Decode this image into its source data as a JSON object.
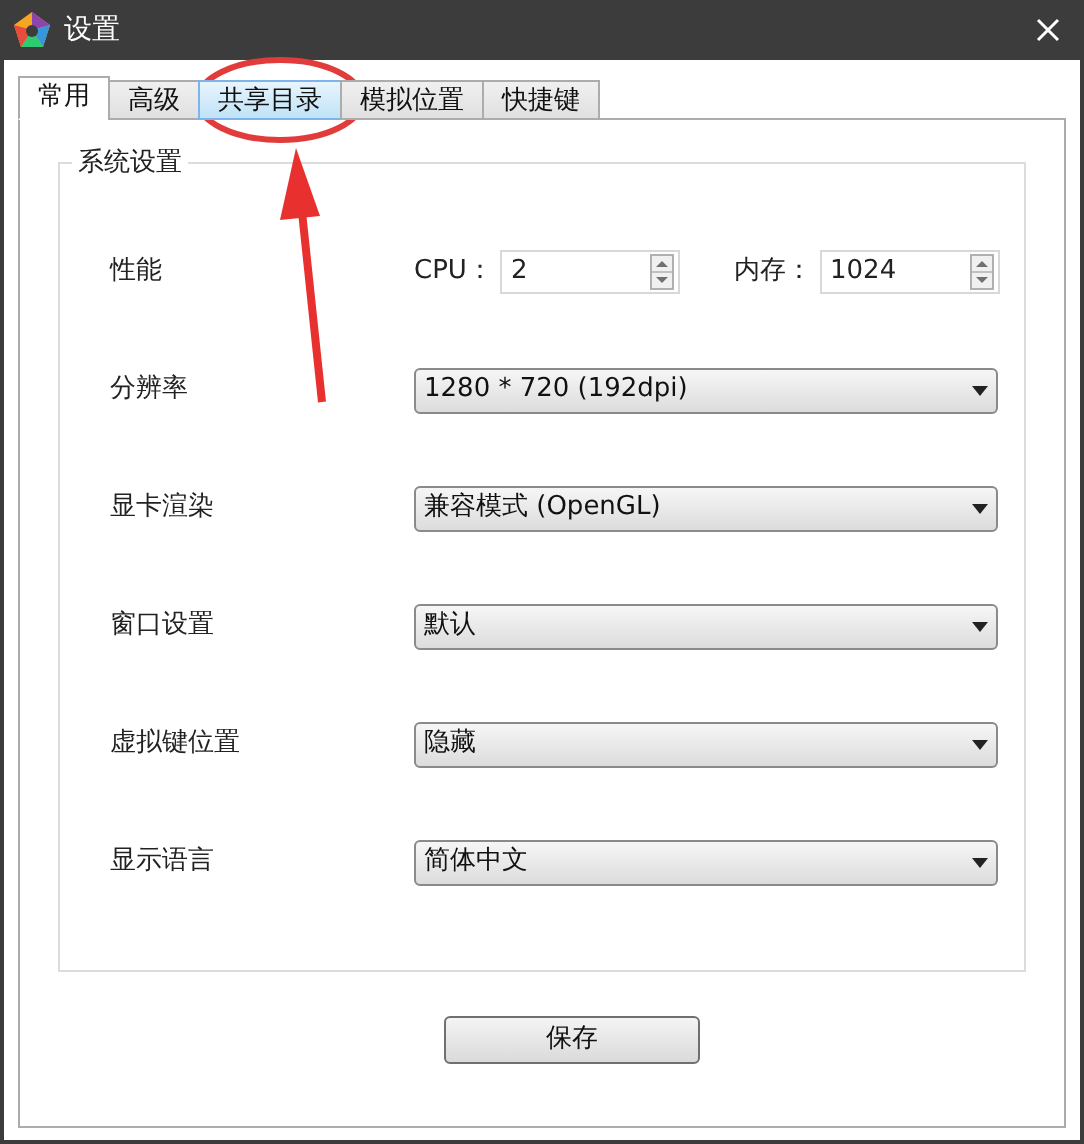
{
  "window": {
    "title": "设置"
  },
  "tabs": [
    {
      "label": "常用",
      "selected": true,
      "hovered": false
    },
    {
      "label": "高级",
      "selected": false,
      "hovered": false
    },
    {
      "label": "共享目录",
      "selected": false,
      "hovered": true
    },
    {
      "label": "模拟位置",
      "selected": false,
      "hovered": false
    },
    {
      "label": "快捷键",
      "selected": false,
      "hovered": false
    }
  ],
  "group": {
    "title": "系统设置",
    "rows": [
      {
        "kind": "spinners",
        "label": "性能",
        "fields": [
          {
            "label": "CPU：",
            "value": "2"
          },
          {
            "label": "内存：",
            "value": "1024"
          }
        ]
      },
      {
        "kind": "dropdown",
        "label": "分辨率",
        "value": "1280 * 720 (192dpi)"
      },
      {
        "kind": "dropdown",
        "label": "显卡渲染",
        "value": "兼容模式 (OpenGL)"
      },
      {
        "kind": "dropdown",
        "label": "窗口设置",
        "value": "默认"
      },
      {
        "kind": "dropdown",
        "label": "虚拟键位置",
        "value": "隐藏"
      },
      {
        "kind": "dropdown",
        "label": "显示语言",
        "value": "简体中文"
      }
    ]
  },
  "buttons": [
    "保存"
  ]
}
